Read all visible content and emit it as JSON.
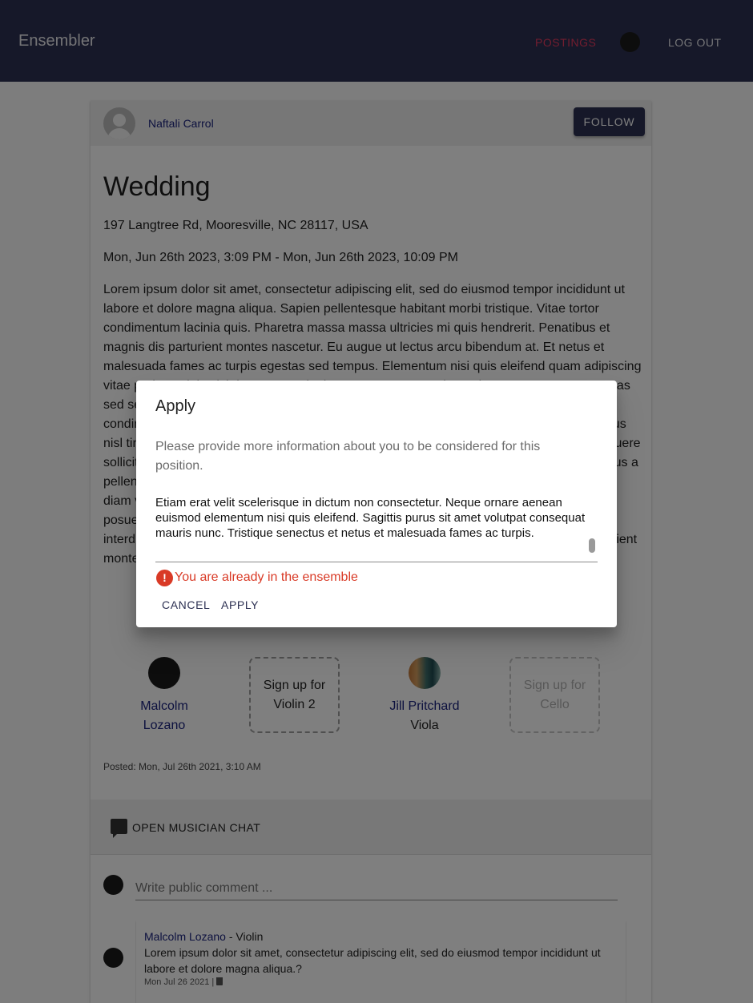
{
  "appbar": {
    "brand": "Ensembler",
    "postings": "POSTINGS",
    "logout": "LOG OUT"
  },
  "posting": {
    "owner": "Naftali Carrol",
    "follow_label": "FOLLOW",
    "title": "Wedding",
    "address": "197 Langtree Rd, Mooresville, NC 28117, USA",
    "date_range": "Mon, Jun 26th 2023, 3:09 PM - Mon, Jun 26th 2023, 10:09 PM",
    "description": "Lorem ipsum dolor sit amet, consectetur adipiscing elit, sed do eiusmod tempor incididunt ut labore et dolore magna aliqua. Sapien pellentesque habitant morbi tristique. Vitae tortor condimentum lacinia quis. Pharetra massa massa ultricies mi quis hendrerit. Penatibus et magnis dis parturient montes nascetur. Eu augue ut lectus arcu bibendum at. Et netus et malesuada fames ac turpis egestas sed tempus. Elementum nisi quis eleifend quam adipiscing vitae proin sagittis nisl rhoncus mattis rhoncus urna neque viverra justo nec. Tempus egestas sed sed risus pretium quam vulputate dignissim suspendisse in. Eget duis at tellus at urna condimentum mattis. Ultrices in iaculis nunc sed augue lacus viverra vitae congue. Faucibus nisl tincidunt eget nullam non nisi est sit amet facilisis magna etiam tempor. Mi in nulla posuere sollicitudin aliquam ultrices sagittis orci a scelerisque purus semper eget duis. Nunc faucibus a pellentesque sit amet porttitor eget dolor morbi non arcu risus quis varius quam quisque id diam vel quam elementum pulvinar etiam non quam lacus suspendisse faucibus interdum posuere lorem ipsum dolor sit amet. Ullamcorper malesuada proin libero nunc consequat interdum varius sit amet mattis vulputate enim nulla aliquet. Penatibus et magnis dis parturient montes nascetur.",
    "posted": "Posted: Mon, Jul 26th 2021, 3:10 AM"
  },
  "slots": [
    {
      "type": "member",
      "name": "Malcolm Lozano"
    },
    {
      "type": "open",
      "label": "Sign up for Violin 2"
    },
    {
      "type": "member",
      "name": "Jill Pritchard",
      "instrument": "Viola"
    },
    {
      "type": "open-disabled",
      "label": "Sign up for Cello"
    }
  ],
  "chat": {
    "open_label": "OPEN MUSICIAN CHAT",
    "comment_placeholder": "Write public comment ..."
  },
  "comments": [
    {
      "author": "Malcolm Lozano",
      "role": " - Violin",
      "text": "Lorem ipsum dolor sit amet, consectetur adipiscing elit, sed do eiusmod tempor incididunt ut labore et dolore magna aliqua.?",
      "date": "Mon Jul 26 2021 | "
    }
  ],
  "dialog": {
    "title": "Apply",
    "prompt": "Please provide more information about you to be considered for this position.",
    "textarea_value": "Etiam erat velit scelerisque in dictum non consectetur. Neque ornare aenean euismod elementum nisi quis eleifend. Sagittis purus sit amet volutpat consequat mauris nunc. Tristique senectus et netus et malesuada fames ac turpis.",
    "error": "You are already in the ensemble",
    "cancel_label": "CANCEL",
    "apply_label": "APPLY"
  },
  "colors": {
    "appbar": "#2c3052",
    "accent_postings": "#e53a5e",
    "link": "#1a237e",
    "error": "#d93a26"
  },
  "icons": [
    "user-avatar-icon",
    "chat-icon",
    "error-icon",
    "trash-icon"
  ]
}
